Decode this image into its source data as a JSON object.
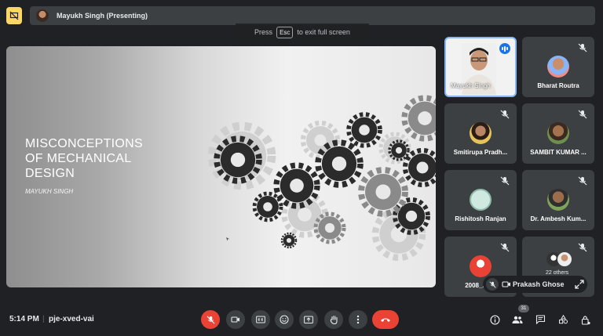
{
  "header": {
    "presenter_label": "Mayukh Singh (Presenting)"
  },
  "fullscreen_hint": {
    "prefix": "Press",
    "key": "Esc",
    "suffix": "to exit full screen"
  },
  "slide": {
    "title": "MISCONCEPTIONS\nOF MECHANICAL\nDESIGN",
    "author": "MAYUKH SINGH"
  },
  "participants": [
    {
      "name": "Mayukh Singh",
      "video": true,
      "speaking": true
    },
    {
      "name": "Bharat Routra",
      "muted": true
    },
    {
      "name": "Smitirupa Pradh...",
      "muted": true
    },
    {
      "name": "SAMBIT KUMAR ...",
      "muted": true
    },
    {
      "name": "Rishitosh Ranjan",
      "muted": true
    },
    {
      "name": "Dr. Ambesh Kum...",
      "muted": true
    },
    {
      "name": "2008_Ama",
      "muted": true
    },
    {
      "name": "22 others",
      "muted": true
    }
  ],
  "self_view": {
    "name": "Prakash Ghose"
  },
  "footer": {
    "time": "5:14 PM",
    "separator": "|",
    "meeting_code": "pje-xved-vai",
    "people_count": "31"
  },
  "colors": {
    "background": "#202124",
    "tile": "#3c4043",
    "danger": "#ea4335",
    "accent": "#8ab4f8",
    "warning": "#fdd663"
  }
}
